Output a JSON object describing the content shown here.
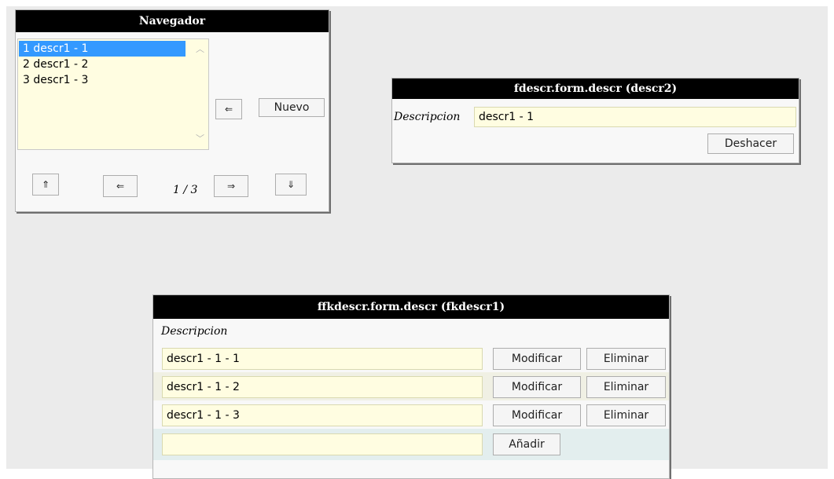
{
  "navigator": {
    "title": "Navegador",
    "items": [
      "1 descr1 - 1",
      "2 descr1 - 2",
      "3 descr1 - 3"
    ],
    "selected_index": 0,
    "back_label": "⇐",
    "new_label": "Nuevo",
    "first_label": "⇑",
    "prev_label": "⇐",
    "page_indicator": "1 / 3",
    "next_label": "⇒",
    "last_label": "⇓"
  },
  "descr_form": {
    "title": "fdescr.form.descr (descr2)",
    "field_label": "Descripcion",
    "field_value": "descr1 - 1",
    "undo_label": "Deshacer"
  },
  "fk_form": {
    "title": "ffkdescr.form.descr (fkdescr1)",
    "column_header": "Descripcion",
    "rows": [
      {
        "value": "descr1 - 1 - 1",
        "modify": "Modificar",
        "delete": "Eliminar"
      },
      {
        "value": "descr1 - 1 - 2",
        "modify": "Modificar",
        "delete": "Eliminar"
      },
      {
        "value": "descr1 - 1 - 3",
        "modify": "Modificar",
        "delete": "Eliminar"
      }
    ],
    "new_row_value": "",
    "add_label": "Añadir"
  },
  "colors": {
    "header_bg": "#000000",
    "input_bg": "#fffde1",
    "selection": "#3399ff",
    "new_row_bg": "#e3eeee",
    "page_bg": "#ebebeb"
  }
}
